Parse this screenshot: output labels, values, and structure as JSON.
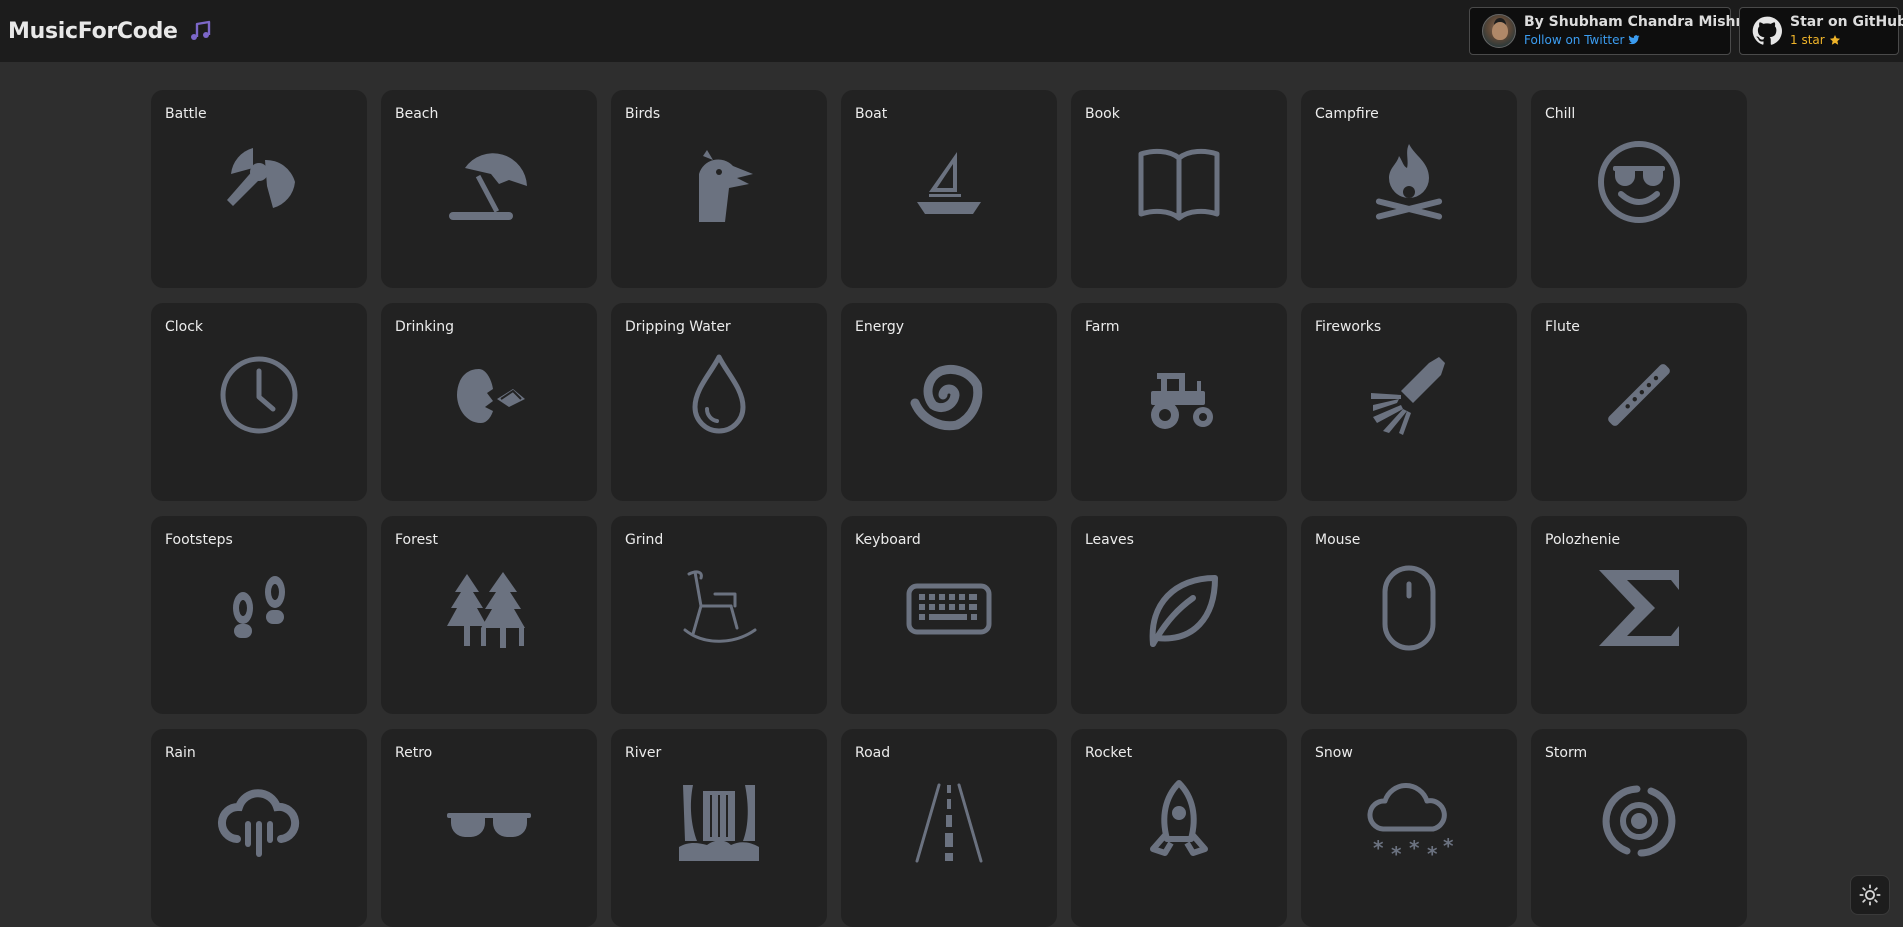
{
  "header": {
    "title": "MusicForCode",
    "author_card": {
      "title": "By Shubham Chandra Mishra",
      "subtitle": "Follow on Twitter"
    },
    "github_card": {
      "title": "Star on GitHub",
      "subtitle": "1 star"
    }
  },
  "colors": {
    "accent_link": "#3b9cf0",
    "star": "#f0b429",
    "icon": "#6b7280",
    "card_bg": "#222222",
    "page_bg": "#2e2e2e"
  },
  "sounds": [
    {
      "label": "Battle",
      "icon": "battle-axe-icon"
    },
    {
      "label": "Beach",
      "icon": "beach-umbrella-icon"
    },
    {
      "label": "Birds",
      "icon": "bird-icon"
    },
    {
      "label": "Boat",
      "icon": "sailboat-icon"
    },
    {
      "label": "Book",
      "icon": "book-icon"
    },
    {
      "label": "Campfire",
      "icon": "campfire-icon"
    },
    {
      "label": "Chill",
      "icon": "sunglasses-smile-icon"
    },
    {
      "label": "Clock",
      "icon": "clock-icon"
    },
    {
      "label": "Drinking",
      "icon": "drinking-icon"
    },
    {
      "label": "Dripping Water",
      "icon": "water-drop-icon"
    },
    {
      "label": "Energy",
      "icon": "vortex-icon"
    },
    {
      "label": "Farm",
      "icon": "tractor-icon"
    },
    {
      "label": "Fireworks",
      "icon": "firework-icon"
    },
    {
      "label": "Flute",
      "icon": "flute-icon"
    },
    {
      "label": "Footsteps",
      "icon": "footsteps-icon"
    },
    {
      "label": "Forest",
      "icon": "forest-icon"
    },
    {
      "label": "Grind",
      "icon": "rocking-chair-icon"
    },
    {
      "label": "Keyboard",
      "icon": "keyboard-icon"
    },
    {
      "label": "Leaves",
      "icon": "leaf-icon"
    },
    {
      "label": "Mouse",
      "icon": "mouse-icon"
    },
    {
      "label": "Polozhenie",
      "icon": "sigma-icon"
    },
    {
      "label": "Rain",
      "icon": "rain-cloud-icon"
    },
    {
      "label": "Retro",
      "icon": "retro-sunglasses-icon"
    },
    {
      "label": "River",
      "icon": "waterfall-icon"
    },
    {
      "label": "Road",
      "icon": "road-icon"
    },
    {
      "label": "Rocket",
      "icon": "rocket-icon"
    },
    {
      "label": "Snow",
      "icon": "snow-cloud-icon"
    },
    {
      "label": "Storm",
      "icon": "storm-icon"
    }
  ],
  "theme_toggle": {
    "icon": "sun-icon"
  }
}
